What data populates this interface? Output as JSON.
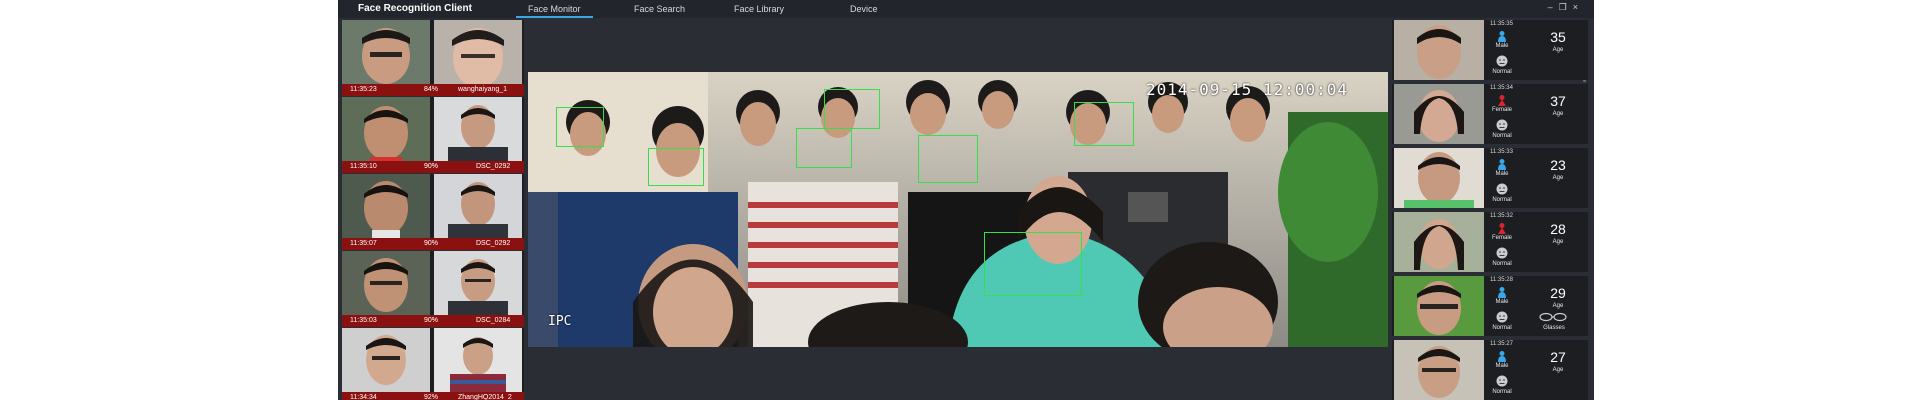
{
  "app": {
    "title": "Face Recognition Client"
  },
  "tabs": [
    {
      "label": "Face Monitor",
      "active": true
    },
    {
      "label": "Face Search",
      "active": false
    },
    {
      "label": "Face Library",
      "active": false
    },
    {
      "label": "Device",
      "active": false
    }
  ],
  "window_controls": {
    "minimize": "–",
    "restore": "❐",
    "close": "×"
  },
  "matches": [
    {
      "time": "11:35:23",
      "similarity": "84%",
      "name": "wanghaiyang_1"
    },
    {
      "time": "11:35:10",
      "similarity": "90%",
      "name": "DSC_0292"
    },
    {
      "time": "11:35:07",
      "similarity": "90%",
      "name": "DSC_0292"
    },
    {
      "time": "11:35:03",
      "similarity": "90%",
      "name": "DSC_0284"
    },
    {
      "time": "11:34:34",
      "similarity": "92%",
      "name": "ZhangHQ2014_2"
    }
  ],
  "video": {
    "timestamp": "2014-09-15 12:00:04",
    "label": "IPC"
  },
  "people": [
    {
      "time": "11:35:35",
      "gender": "Male",
      "age": "35",
      "age_label": "Age",
      "expression": "Normal",
      "glasses": ""
    },
    {
      "time": "11:35:34",
      "gender": "Female",
      "age": "37",
      "age_label": "Age",
      "expression": "Normal",
      "glasses": ""
    },
    {
      "time": "11:35:33",
      "gender": "Male",
      "age": "23",
      "age_label": "Age",
      "expression": "Normal",
      "glasses": ""
    },
    {
      "time": "11:35:32",
      "gender": "Female",
      "age": "28",
      "age_label": "Age",
      "expression": "Normal",
      "glasses": ""
    },
    {
      "time": "11:35:28",
      "gender": "Male",
      "age": "29",
      "age_label": "Age",
      "expression": "Normal",
      "glasses": "Glasses"
    },
    {
      "time": "11:35:27",
      "gender": "Male",
      "age": "27",
      "age_label": "Age",
      "expression": "Normal",
      "glasses": ""
    }
  ],
  "colors": {
    "accent": "#3aa6e6",
    "match_bar": "#8b1111",
    "detection_box": "#37e04a",
    "male_icon": "#3aa6e6",
    "female_icon": "#d9262c"
  }
}
